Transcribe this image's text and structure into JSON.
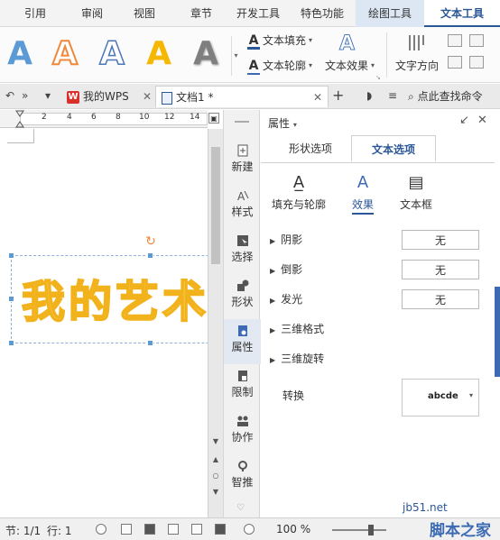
{
  "ribbon_tabs": [
    {
      "label": "引用"
    },
    {
      "label": "审阅"
    },
    {
      "label": "视图"
    },
    {
      "label": "章节"
    },
    {
      "label": "开发工具"
    },
    {
      "label": "特色功能"
    },
    {
      "label": "绘图工具"
    },
    {
      "label": "文本工具"
    }
  ],
  "ribbon": {
    "wordart_styles": [
      "A",
      "A",
      "A",
      "A",
      "A"
    ],
    "text_fill": "文本填充",
    "text_outline": "文本轮廓",
    "text_effects": "文本效果",
    "text_direction": "文字方向"
  },
  "quickbar": {
    "tabs": [
      {
        "label": "我的WPS",
        "logo": "W"
      },
      {
        "label": "文档1 *"
      }
    ],
    "new_tab": "+",
    "search": "点此查找命令"
  },
  "ruler": {
    "ticks": [
      "2",
      "4",
      "6",
      "8",
      "10",
      "12",
      "14"
    ]
  },
  "document": {
    "wordart_text": "我的艺术字"
  },
  "sidebar": {
    "items": [
      {
        "label": "新建",
        "icon": "new-icon"
      },
      {
        "label": "样式",
        "icon": "style-icon"
      },
      {
        "label": "选择",
        "icon": "select-icon"
      },
      {
        "label": "形状",
        "icon": "shape-icon"
      },
      {
        "label": "属性",
        "icon": "property-icon"
      },
      {
        "label": "限制",
        "icon": "restrict-icon"
      },
      {
        "label": "协作",
        "icon": "collab-icon"
      },
      {
        "label": "智推",
        "icon": "recommend-icon"
      }
    ]
  },
  "pane": {
    "title": "属性",
    "tabs": [
      "形状选项",
      "文本选项"
    ],
    "subtabs": [
      {
        "label": "填充与轮廓",
        "icon": "fill-outline-icon"
      },
      {
        "label": "效果",
        "icon": "effect-icon"
      },
      {
        "label": "文本框",
        "icon": "textbox-icon"
      }
    ],
    "rows": [
      {
        "label": "阴影",
        "value": "无"
      },
      {
        "label": "倒影",
        "value": "无"
      },
      {
        "label": "发光",
        "value": "无"
      },
      {
        "label": "三维格式",
        "value": ""
      },
      {
        "label": "三维旋转",
        "value": ""
      }
    ],
    "convert_label": "转换",
    "convert_value": "abcde"
  },
  "status": {
    "section": "节: 1/1",
    "line": "行: 1",
    "zoom": "100 %"
  },
  "watermark": {
    "url": "jb51.net",
    "brand": "脚本之家"
  },
  "colors": {
    "accent": "#2b5797",
    "wordart_fill": "#ffe98a",
    "wordart_stroke": "#f2b21c"
  }
}
